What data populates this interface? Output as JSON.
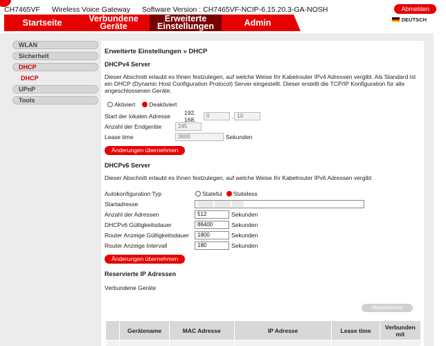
{
  "header": {
    "model": "CH7465VF",
    "product": "Wireless Voice Gateway",
    "software_version": "Software Version : CH7465VF-NCIP-6.15.20.3-GA-NOSH",
    "logout_label": "Abmelden",
    "language": "DEUTSCH"
  },
  "nav": {
    "tabs": [
      {
        "label": "Startseite"
      },
      {
        "label": "Verbundene Geräte"
      },
      {
        "label": "Erweiterte Einstellungen"
      },
      {
        "label": "Admin"
      }
    ]
  },
  "sidebar": {
    "items": [
      "WLAN",
      "Sicherheit",
      "DHCP",
      "UPnP",
      "Tools"
    ],
    "sub_item": "DHCP"
  },
  "page": {
    "breadcrumb": "Erweiterte Einstellungen » DHCP",
    "v4": {
      "title": "DHCPv4 Server",
      "description": "Dieser Abschnitt erlaubt es Ihnen festzulegen, auf welche Weise Ihr Kabelrouter IPv4 Adressen vergibt. Als Standard ist ein DHCP (Dynamic Host Configuration Protocol) Server eingestellt. Dieser erstellt die TCP/IP Konfiguration für alle angeschlossenen Geräte.",
      "radio_on": "Aktiviert",
      "radio_off": "Deaktiviert",
      "start_label": "Start der lokalen Adresse",
      "start_prefix": "192. 168.",
      "start_octet3": "0",
      "start_octet4": "10",
      "count_label": "Anzahl der Endgeräte",
      "count_value": "245",
      "lease_label": "Lease time",
      "lease_value": "3600",
      "lease_unit": "Sekunden",
      "apply_label": "Änderungen übernehmen"
    },
    "v6": {
      "title": "DHCPv6 Server",
      "description": "Dieser Abschnitt erlaubt es Ihnen festzulegen, auf welche Weise Ihr Kabelrouter IPv6 Adressen vergibt",
      "autoconf_label": "Autokonfiguration Typ",
      "stateful": "Stateful",
      "stateless": "Stateless",
      "start_label": "Startadresse",
      "count_label": "Anzahl der Adressen",
      "count_value": "512",
      "validity_label": "DHCPv6 Gültigkeitsdauer",
      "validity_value": "86400",
      "ra_validity_label": "Router Anzeige Gültigkeitsdauer",
      "ra_validity_value": "1800",
      "ra_interval_label": "Router Anzeige Intervall",
      "ra_interval_value": "180",
      "unit": "Sekunden",
      "apply_label": "Änderungen übernehmen"
    },
    "reserved": {
      "title": "Reservierte IP Adressen",
      "connected_label": "Verbundene Geräte",
      "refresh_label": "Aktualisieren",
      "columns": [
        "Gerätename",
        "MAC Adresse",
        "IP Adresse",
        "Lease time",
        "Verbunden mit"
      ]
    }
  }
}
